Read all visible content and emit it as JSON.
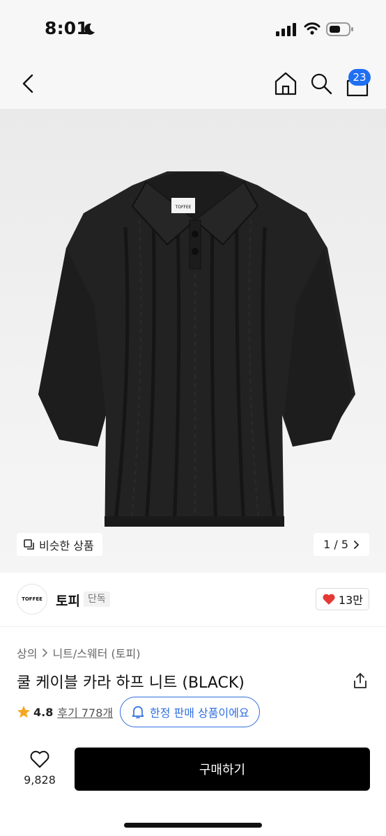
{
  "status_bar": {
    "time": "8:01"
  },
  "nav": {
    "cart_count": "23"
  },
  "gallery": {
    "similar_label": "비슷한 상품",
    "page_indicator": "1 / 5",
    "tag_text": "TOFFEE"
  },
  "brand": {
    "logo_text": "TOFFEE",
    "name": "토피",
    "badge": "단독",
    "likes": "13만"
  },
  "product": {
    "breadcrumb": [
      "상의",
      "니트/스웨터 (토피)"
    ],
    "title": "쿨 케이블 카라 하프 니트 (BLACK)",
    "rating": "4.8",
    "reviews": "후기 778개",
    "limited_notice": "한정 판매 상품이에요"
  },
  "bottom": {
    "favorite_count": "9,828",
    "buy_label": "구매하기"
  },
  "colors": {
    "accent": "#2f6fe0",
    "badge": "#1f6ff2",
    "heart": "#e53935",
    "star": "#f5a623"
  }
}
